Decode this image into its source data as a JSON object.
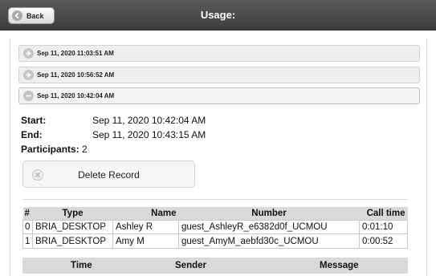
{
  "header": {
    "back_label": "Back",
    "title": "Usage:"
  },
  "sessions": [
    {
      "label": "Sep 11, 2020 11:03:51 AM",
      "state": "collapsed"
    },
    {
      "label": "Sep 11, 2020 10:56:52 AM",
      "state": "collapsed"
    },
    {
      "label": "Sep 11, 2020 10:42:04 AM",
      "state": "expanded"
    }
  ],
  "detail": {
    "start_label": "Start:",
    "start_value": "Sep 11, 2020 10:42:04 AM",
    "end_label": "End:",
    "end_value": "Sep 11, 2020 10:43:15 AM",
    "participants_label": "Participants:",
    "participants_value": "2",
    "delete_label": "Delete Record"
  },
  "participants_table": {
    "headers": {
      "index": "#",
      "type": "Type",
      "name": "Name",
      "number": "Number",
      "call_time": "Call time"
    },
    "rows": [
      {
        "index": "0",
        "type": "BRIA_DESKTOP",
        "name": "Ashley R",
        "number": "guest_AshleyR_e6382d0f_UCMOU",
        "call_time": "0:01:10"
      },
      {
        "index": "1",
        "type": "BRIA_DESKTOP",
        "name": "Amy M",
        "number": "guest_AmyM_aebfd30c_UCMOU",
        "call_time": "0:00:52"
      }
    ]
  },
  "messages_table": {
    "headers": {
      "time": "Time",
      "sender": "Sender",
      "message": "Message"
    }
  },
  "icons": {
    "back": "back-arrow-icon",
    "collapsed": "plus-circle-icon",
    "expanded": "minus-circle-icon",
    "delete": "close-circle-icon"
  },
  "colors": {
    "titlebar": "#4a4a4a",
    "header_row": "#d9d9d9",
    "accordion": "#eeeeee"
  }
}
